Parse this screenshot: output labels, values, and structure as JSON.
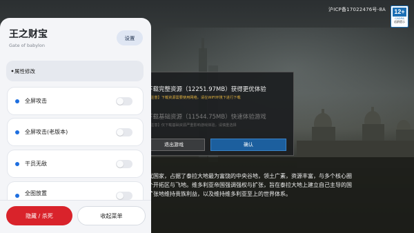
{
  "header": {
    "icp_text": "沪ICP备17022476号-8A",
    "age_rating": {
      "number": "12+",
      "org": "CADPA",
      "tip": "适龄提示"
    }
  },
  "download_dialog": {
    "option_full": {
      "title": "下载完整资源（12251.97MB）获得更优体验",
      "note": "【注意】下载资源需要使用网络，请在WIFI环境下进行下载"
    },
    "option_basic": {
      "title": "下载基础资源（11544.75MB）快速体验游戏",
      "note": "【注意】仅下载基础资源严重影响游戏体验，请慎重选择"
    },
    "exit_button": "退出游戏",
    "confirm_button": "确认"
  },
  "story_text": [
    "代国家，占据了泰拉大地最为富饶的中央谷地，领土广素，资源丰富，与多个核心圈",
    "个开拓区与飞地。维多利亚帝国强调强权与扩张，旨在泰拉大地上建立自己主导的国",
    "扩张地维持贵族利益，以及维持维多利亚至上的世界体系。"
  ],
  "mod_panel": {
    "title": "王之财宝",
    "subtitle": "Gate of babylon",
    "settings_button": "设置",
    "section_label": "属性修改",
    "items": [
      {
        "label": "全屏攻击",
        "enabled": false
      },
      {
        "label": "全屏攻击(老版本)",
        "enabled": false
      },
      {
        "label": "干员无敌",
        "enabled": false
      },
      {
        "label": "全图放置",
        "enabled": false
      }
    ],
    "hide_button": "隐藏 / 杀死",
    "collapse_button": "收起菜单"
  },
  "colors": {
    "accent_blue": "#1e6fe0",
    "danger_red": "#d9232b",
    "confirm_blue": "#1c5f9e",
    "note_gold": "#e0b13f"
  }
}
